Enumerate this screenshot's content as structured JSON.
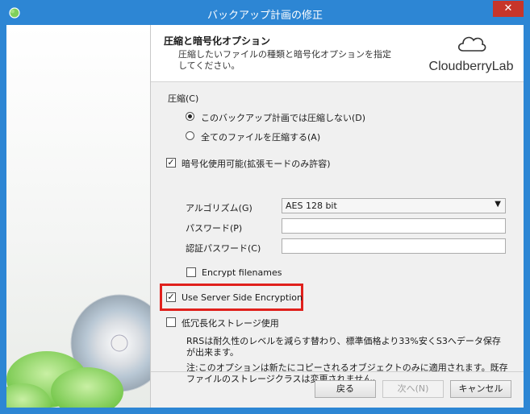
{
  "window": {
    "title": "バックアップ計画の修正",
    "close_label": "✕"
  },
  "header": {
    "title": "圧縮と暗号化オプション",
    "description": "圧縮したいファイルの種類と暗号化オプションを指定してください。",
    "logo_text": "CloudberryLab"
  },
  "compression": {
    "group_label": "圧縮(C)",
    "options": [
      {
        "label": "このバックアップ計画では圧縮しない(D)",
        "selected": true
      },
      {
        "label": "全てのファイルを圧縮する(A)",
        "selected": false
      }
    ]
  },
  "encryption": {
    "enable_label": "暗号化使用可能(拡張モードのみ許容)",
    "enabled": true,
    "algorithm_label": "アルゴリズム(G)",
    "algorithm_value": "AES 128 bit",
    "password_label": "パスワード(P)",
    "password_value": "",
    "confirm_label": "認証パスワード(C)",
    "confirm_value": "",
    "encrypt_filenames_label": "Encrypt filenames",
    "encrypt_filenames": false
  },
  "sse": {
    "label": "Use Server Side Encryption",
    "checked": true
  },
  "rrs": {
    "label": "低冗長化ストレージ使用",
    "checked": false,
    "note1": "RRSは耐久性のレベルを減らす替わり、標準価格より33%安くS3へデータ保存が出来ます。",
    "note2": "注:このオプションは新たにコピーされるオブジェクトのみに適用されます。既存ファイルのストレージクラスは変更されません。"
  },
  "buttons": {
    "back": "戻る",
    "next": "次へ(N)",
    "cancel": "キャンセル"
  },
  "colors": {
    "titlebar": "#2d86d4",
    "close": "#c7352a",
    "highlight": "#e0201c"
  }
}
